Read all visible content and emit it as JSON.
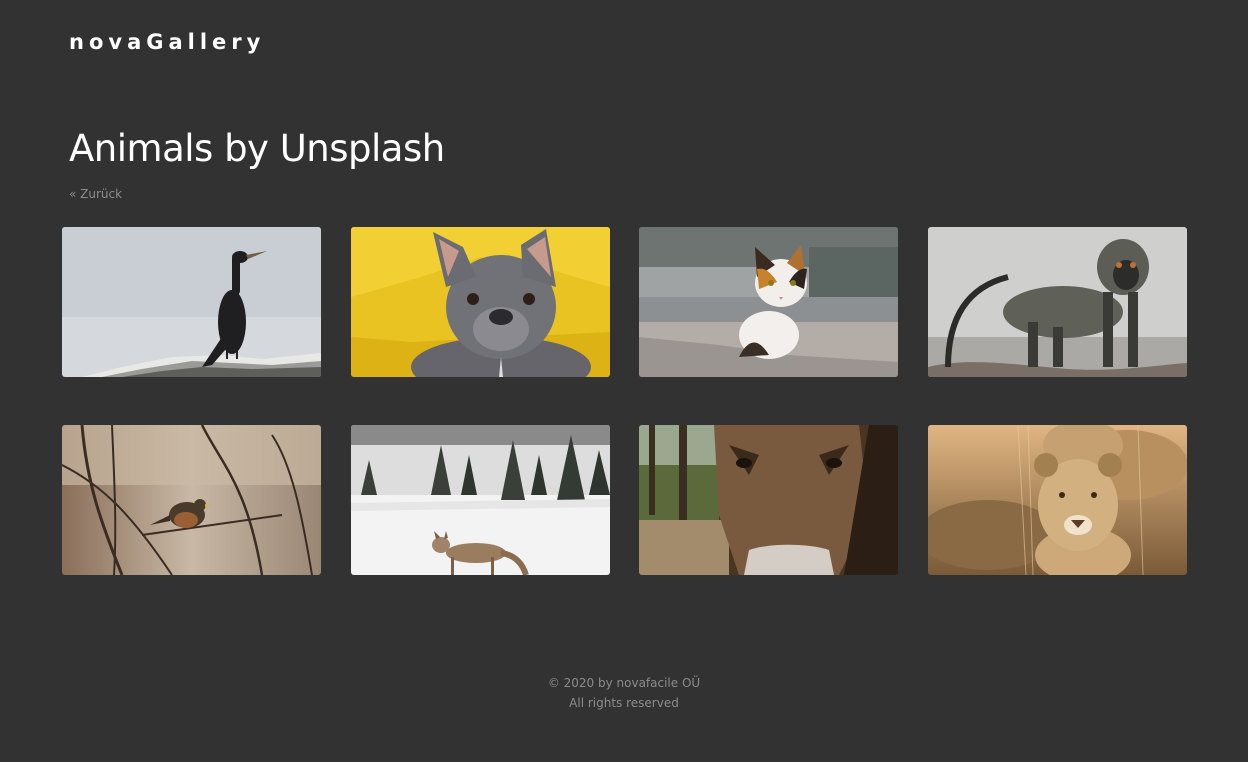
{
  "header": {
    "brand": "novaGallery"
  },
  "gallery": {
    "title": "Animals by Unsplash",
    "back_label": "« Zurück"
  },
  "images": [
    {
      "subject": "cormorant-on-rock"
    },
    {
      "subject": "french-bulldog-yellow-blanket"
    },
    {
      "subject": "calico-cat"
    },
    {
      "subject": "vervet-monkey"
    },
    {
      "subject": "robin-on-branches"
    },
    {
      "subject": "coyote-in-snow"
    },
    {
      "subject": "donkey-closeup"
    },
    {
      "subject": "lioness"
    }
  ],
  "footer": {
    "copyright": "© 2020 by novafacile OÜ",
    "rights": "All rights reserved"
  }
}
